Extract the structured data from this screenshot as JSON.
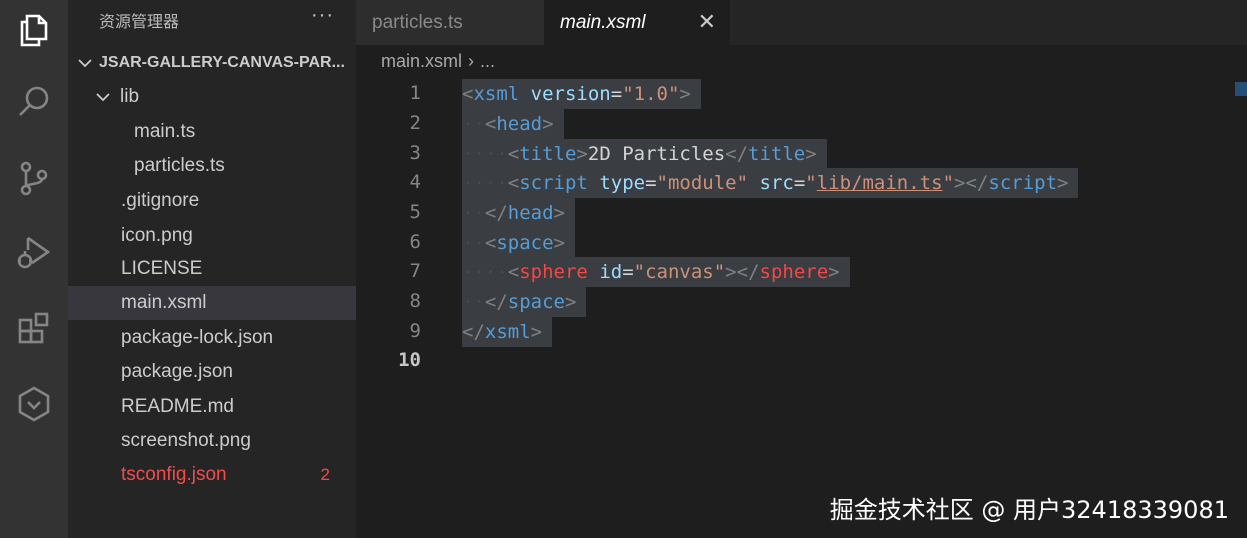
{
  "activity_bar": {
    "icons": [
      "files-icon",
      "search-icon",
      "source-control-icon",
      "run-debug-icon",
      "extensions-icon",
      "remote-icon"
    ]
  },
  "sidebar": {
    "title": "资源管理器",
    "more": "···",
    "root_label": "JSAR-GALLERY-CANVAS-PAR...",
    "items": [
      {
        "label": "lib",
        "type": "folder"
      },
      {
        "label": "main.ts",
        "type": "file"
      },
      {
        "label": "particles.ts",
        "type": "file"
      },
      {
        "label": ".gitignore",
        "type": "file"
      },
      {
        "label": "icon.png",
        "type": "file"
      },
      {
        "label": "LICENSE",
        "type": "file"
      },
      {
        "label": "main.xsml",
        "type": "file",
        "selected": true
      },
      {
        "label": "package-lock.json",
        "type": "file"
      },
      {
        "label": "package.json",
        "type": "file"
      },
      {
        "label": "README.md",
        "type": "file"
      },
      {
        "label": "screenshot.png",
        "type": "file"
      },
      {
        "label": "tsconfig.json",
        "type": "file",
        "error": true,
        "badge": "2"
      }
    ]
  },
  "tabs": [
    {
      "label": "particles.ts",
      "active": false
    },
    {
      "label": "main.xsml",
      "active": true,
      "close": "✕"
    }
  ],
  "breadcrumb": {
    "file": "main.xsml",
    "sep": "›",
    "more": "..."
  },
  "line_numbers": [
    "1",
    "2",
    "3",
    "4",
    "5",
    "6",
    "7",
    "8",
    "9",
    "10"
  ],
  "code": {
    "l1": {
      "open": "<",
      "tag": "xsml",
      "attr": "version",
      "eq": "=",
      "val": "\"1.0\"",
      "close": ">"
    },
    "l2": {
      "ws": "··",
      "open": "<",
      "tag": "head",
      "close": ">"
    },
    "l3": {
      "ws": "····",
      "open": "<",
      "tag": "title",
      "close": ">",
      "text": "2D Particles",
      "endopen": "</",
      "endtag": "title",
      "endclose": ">"
    },
    "l4": {
      "ws": "····",
      "open": "<",
      "tag": "script",
      "attr1": "type",
      "eq": "=",
      "val1": "\"module\"",
      "attr2": "src",
      "val2q1": "\"",
      "val2": "lib/main.ts",
      "val2q2": "\"",
      "close": ">",
      "endopen": "</",
      "endtag": "script",
      "endclose": ">"
    },
    "l5": {
      "ws": "··",
      "open": "</",
      "tag": "head",
      "close": ">"
    },
    "l6": {
      "ws": "··",
      "open": "<",
      "tag": "space",
      "close": ">"
    },
    "l7": {
      "ws": "····",
      "open": "<",
      "tag": "sphere",
      "attr": "id",
      "eq": "=",
      "val": "\"canvas\"",
      "close": ">",
      "endopen": "</",
      "endtag": "sphere",
      "endclose": ">"
    },
    "l8": {
      "ws": "··",
      "open": "</",
      "tag": "space",
      "close": ">"
    },
    "l9": {
      "open": "</",
      "tag": "xsml",
      "close": ">"
    }
  },
  "watermark": "掘金技术社区 @ 用户32418339081",
  "colors": {
    "activity_bar": "#333333",
    "sidebar": "#252526",
    "editor": "#1e1e1e",
    "selection": "#3a3d41",
    "error": "#f14c4c"
  }
}
